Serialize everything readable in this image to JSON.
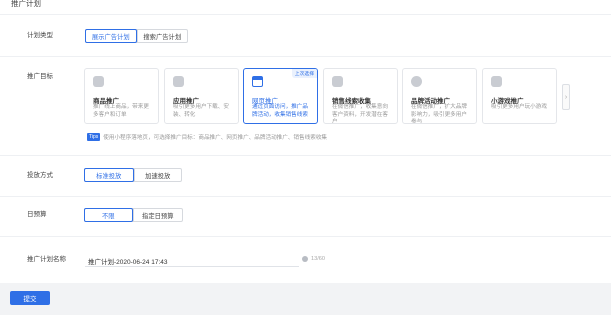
{
  "section_title": "推广计划",
  "plan_type": {
    "label": "计划类型",
    "options": [
      "展示广告计划",
      "搜索广告计划"
    ],
    "selected": "展示广告计划"
  },
  "promo_target": {
    "label": "推广目标",
    "cards": [
      {
        "title": "商品推广",
        "desc": "推广线上商品，带来更多客户和订单"
      },
      {
        "title": "应用推广",
        "desc": "吸引更多用户下载、安装、转化"
      },
      {
        "title": "网页推广",
        "desc": "通过页面访问，推广品牌活动，收集销售线索",
        "tag": "上次选择"
      },
      {
        "title": "销售线索收集",
        "desc": "在微信推广，收集意向客户资料，开发潜在客户"
      },
      {
        "title": "品牌活动推广",
        "desc": "在微信推广，扩大品牌影响力，吸引更多用户参与"
      },
      {
        "title": "小游戏推广",
        "desc": "吸引更多用户玩小游戏"
      }
    ],
    "selected": "网页推广",
    "tips_badge": "Tips",
    "tips_text": "使用小程序落地页，可选择推广目标：商品推广、网页推广、品牌活动推广、销售线索收集"
  },
  "delivery_mode": {
    "label": "投放方式",
    "options": [
      "标准投放",
      "加速投放"
    ],
    "selected": "标准投放"
  },
  "daily_budget": {
    "label": "日预算",
    "options": [
      "不限",
      "指定日预算"
    ],
    "selected": "不限"
  },
  "plan_name": {
    "label": "推广计划名称",
    "value": "推广计划-2020-06-24 17:43",
    "counter": "13/60"
  },
  "submit_label": "提交",
  "colors": {
    "accent": "#2f6fe6",
    "bottom_bar": "#f2f3f5"
  }
}
